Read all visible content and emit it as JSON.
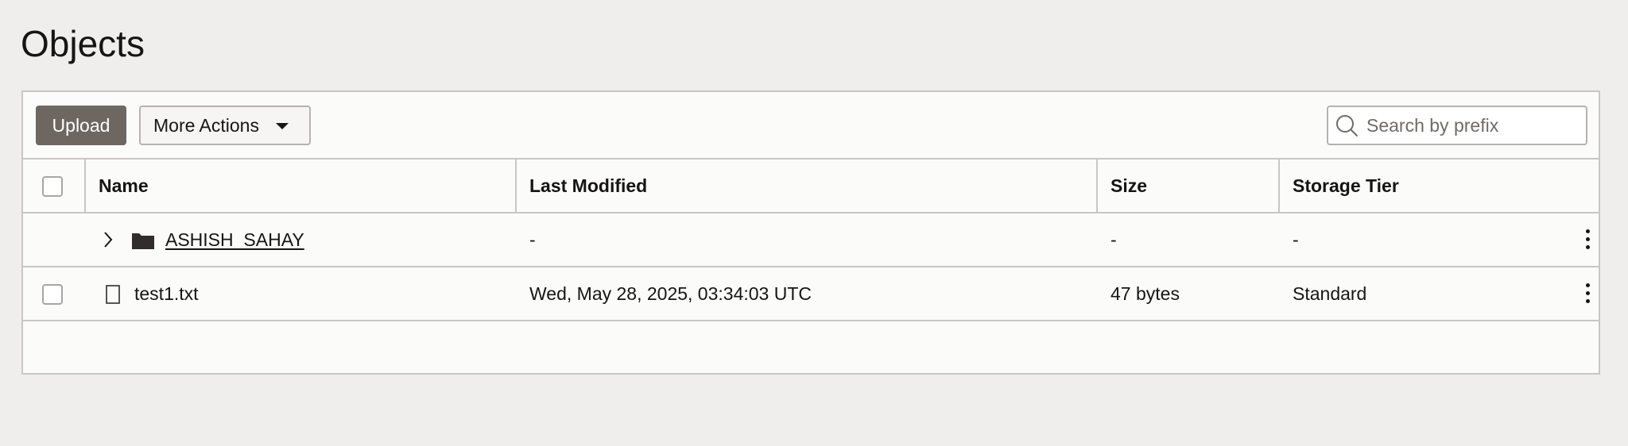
{
  "page": {
    "title": "Objects"
  },
  "toolbar": {
    "upload_label": "Upload",
    "more_actions_label": "More Actions",
    "search_placeholder": "Search by prefix",
    "search_value": ""
  },
  "table": {
    "columns": [
      "Name",
      "Last Modified",
      "Size",
      "Storage Tier"
    ],
    "rows": [
      {
        "type": "folder",
        "name": "ASHISH_SAHAY",
        "last_modified": "-",
        "size": "-",
        "storage_tier": "-",
        "icons": [
          "chevron-right-icon",
          "folder-icon",
          "kebab-menu-icon"
        ]
      },
      {
        "type": "file",
        "name": "test1.txt",
        "last_modified": "Wed, May 28, 2025, 03:34:03 UTC",
        "size": "47 bytes",
        "storage_tier": "Standard",
        "icons": [
          "file-icon",
          "kebab-menu-icon"
        ]
      }
    ]
  },
  "colors": {
    "primary_button": "#6e6761",
    "background": "#efeeec",
    "panel": "#fbfbfa",
    "border": "#c9c7c4"
  }
}
